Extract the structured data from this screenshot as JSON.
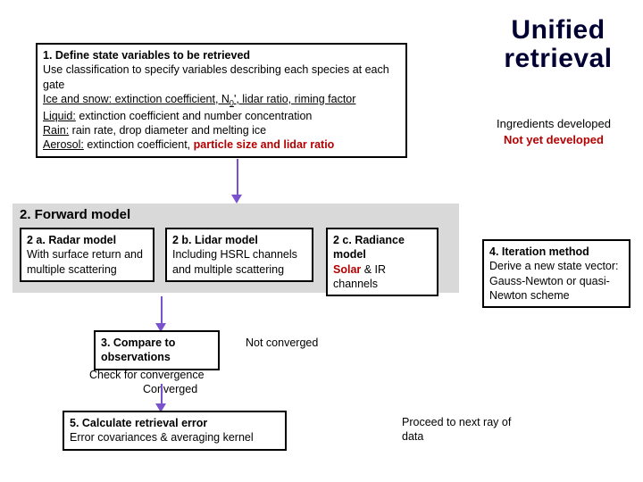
{
  "title_line1": "Unified",
  "title_line2": "retrieval",
  "status": {
    "developed": "Ingredients developed",
    "notyet": "Not yet developed"
  },
  "step1": {
    "title": "1. Define state variables to be retrieved",
    "line1": "Use classification to specify variables describing each species at each gate",
    "ice_label": "Ice and snow:",
    "ice_rest1": " extinction coefficient, N",
    "ice_sub": "0",
    "ice_rest2": "', lidar ratio, ",
    "ice_riming": "riming factor",
    "liquid_label": "Liquid:",
    "liquid_rest": " extinction coefficient and number concentration",
    "rain_label": "Rain:",
    "rain_rest": " rain rate, drop diameter ",
    "rain_melt": "and melting ice",
    "aerosol_label": "Aerosol:",
    "aerosol_rest": " extinction coefficient, ",
    "aerosol_red": "particle size and lidar ratio"
  },
  "forward_header": "2. Forward model",
  "step2a": {
    "title": "2 a. Radar model",
    "body": "With surface return and multiple scattering"
  },
  "step2b": {
    "title": "2 b. Lidar model",
    "body": "Including HSRL channels and multiple scattering"
  },
  "step2c": {
    "title": "2 c. Radiance model",
    "solar": "Solar",
    "amp": " & IR channels"
  },
  "step3": {
    "title": "3. Compare to observations",
    "check": "Check for convergence",
    "converged": "Converged",
    "notconv": "Not converged"
  },
  "step4": {
    "title": "4. Iteration method",
    "body": "Derive a new state vector: Gauss-Newton or quasi-Newton scheme"
  },
  "step5": {
    "title": "5. Calculate retrieval error",
    "body": "Error covariances & averaging kernel"
  },
  "proceed": "Proceed to next ray of data"
}
